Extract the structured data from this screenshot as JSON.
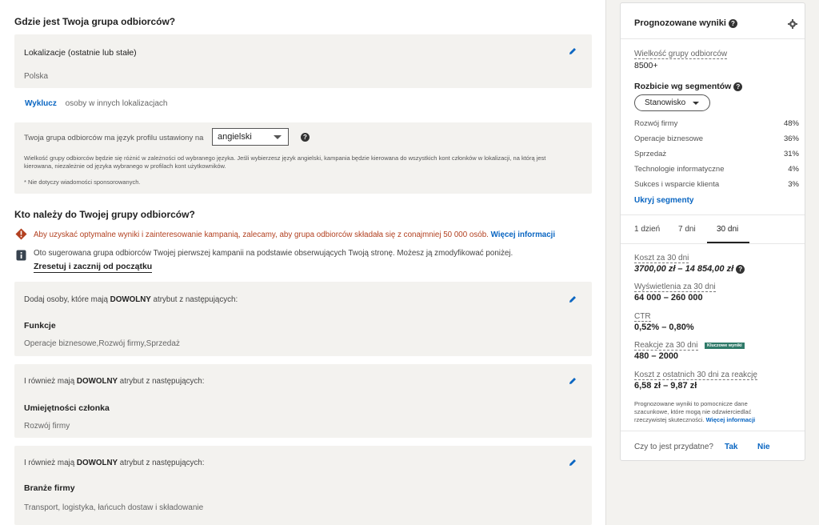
{
  "audience_location": {
    "heading": "Gdzie jest Twoja grupa odbiorców?",
    "locations_title": "Lokalizacje (ostatnie lub stałe)",
    "locations_value": "Polska",
    "exclude_link": "Wyklucz",
    "exclude_text": "osoby w innych lokalizacjach",
    "language_prefix": "Twoja grupa odbiorców ma język profilu ustawiony na",
    "language_value": "angielski",
    "language_note": "Wielkość grupy odbiorców będzie się różnić w zależności od wybranego języka. Jeśli wybierzesz język angielski, kampania będzie kierowana do wszystkich kont członków w lokalizacji, na którą jest kierowana, niezależnie od języka wybranego w profilach kont użytkowników.",
    "language_footnote": "* Nie dotyczy wiadomości sponsorowanych."
  },
  "audience_who": {
    "heading": "Kto należy do Twojej grupy odbiorców?",
    "warning_text": "Aby uzyskać optymalne wyniki i zainteresowanie kampanią, zalecamy, aby grupa odbiorców składała się z conajmniej 50 000 osób.",
    "warning_link": "Więcej informacji",
    "info_text": "Oto sugerowana grupa odbiorców Twojej pierwszej kampanii na podstawie obserwujących Twoją stronę. Możesz ją zmodyfikować poniżej.",
    "reset_link": "Zresetuj i zacznij od początku",
    "groups": [
      {
        "pre": "Dodaj osoby, które mają",
        "bold": "DOWOLNY",
        "post": "atrybut z następujących:",
        "title": "Funkcje",
        "values": "Operacje biznesowe,Rozwój firmy,Sprzedaż"
      },
      {
        "pre": "I również mają",
        "bold": "DOWOLNY",
        "post": "atrybut z następujących:",
        "title": "Umiejętności członka",
        "values": "Rozwój firmy"
      },
      {
        "pre": "I również mają",
        "bold": "DOWOLNY",
        "post": "atrybut z następujących:",
        "title": "Branże firmy",
        "values": "Transport, logistyka, łańcuch dostaw i składowanie"
      }
    ]
  },
  "forecast": {
    "title": "Prognozowane wyniki",
    "size_label": "Wielkość grupy odbiorców",
    "size_value": "8500+",
    "breakdown_label": "Rozbicie wg segmentów",
    "segment_select": "Stanowisko",
    "segments": [
      {
        "name": "Rozwój firmy",
        "pct": "48%"
      },
      {
        "name": "Operacje biznesowe",
        "pct": "36%"
      },
      {
        "name": "Sprzedaż",
        "pct": "31%"
      },
      {
        "name": "Technologie informatyczne",
        "pct": "4%"
      },
      {
        "name": "Sukces i wsparcie klienta",
        "pct": "3%"
      }
    ],
    "hide_segments": "Ukryj segmenty",
    "tabs": [
      "1 dzień",
      "7 dni",
      "30 dni"
    ],
    "active_tab_index": 2,
    "metrics": [
      {
        "label": "Koszt za 30 dni",
        "value": "3700,00 zł – 14 854,00 zł"
      },
      {
        "label": "Wyświetlenia za 30 dni",
        "value": "64 000 – 260 000"
      },
      {
        "label": "CTR",
        "value": "0,52% – 0,80%"
      },
      {
        "label": "Reakcje za 30 dni",
        "value": "480 – 2000",
        "badge": "Kluczowe wyniki"
      },
      {
        "label": "Koszt z ostatnich 30 dni za reakcję",
        "value": "6,58 zł – 9,87 zł"
      }
    ],
    "disclaimer": "Prognozowane wyniki to pomocnicze dane szacunkowe, które mogą nie odzwierciedlać rzeczywistej skuteczności.",
    "disclaimer_link": "Więcej informacji",
    "feedback_question": "Czy to jest przydatne?",
    "feedback_yes": "Tak",
    "feedback_no": "Nie"
  },
  "colors": {
    "link": "#0a66c2",
    "warning": "#b24020",
    "badge": "#2f7a69"
  }
}
